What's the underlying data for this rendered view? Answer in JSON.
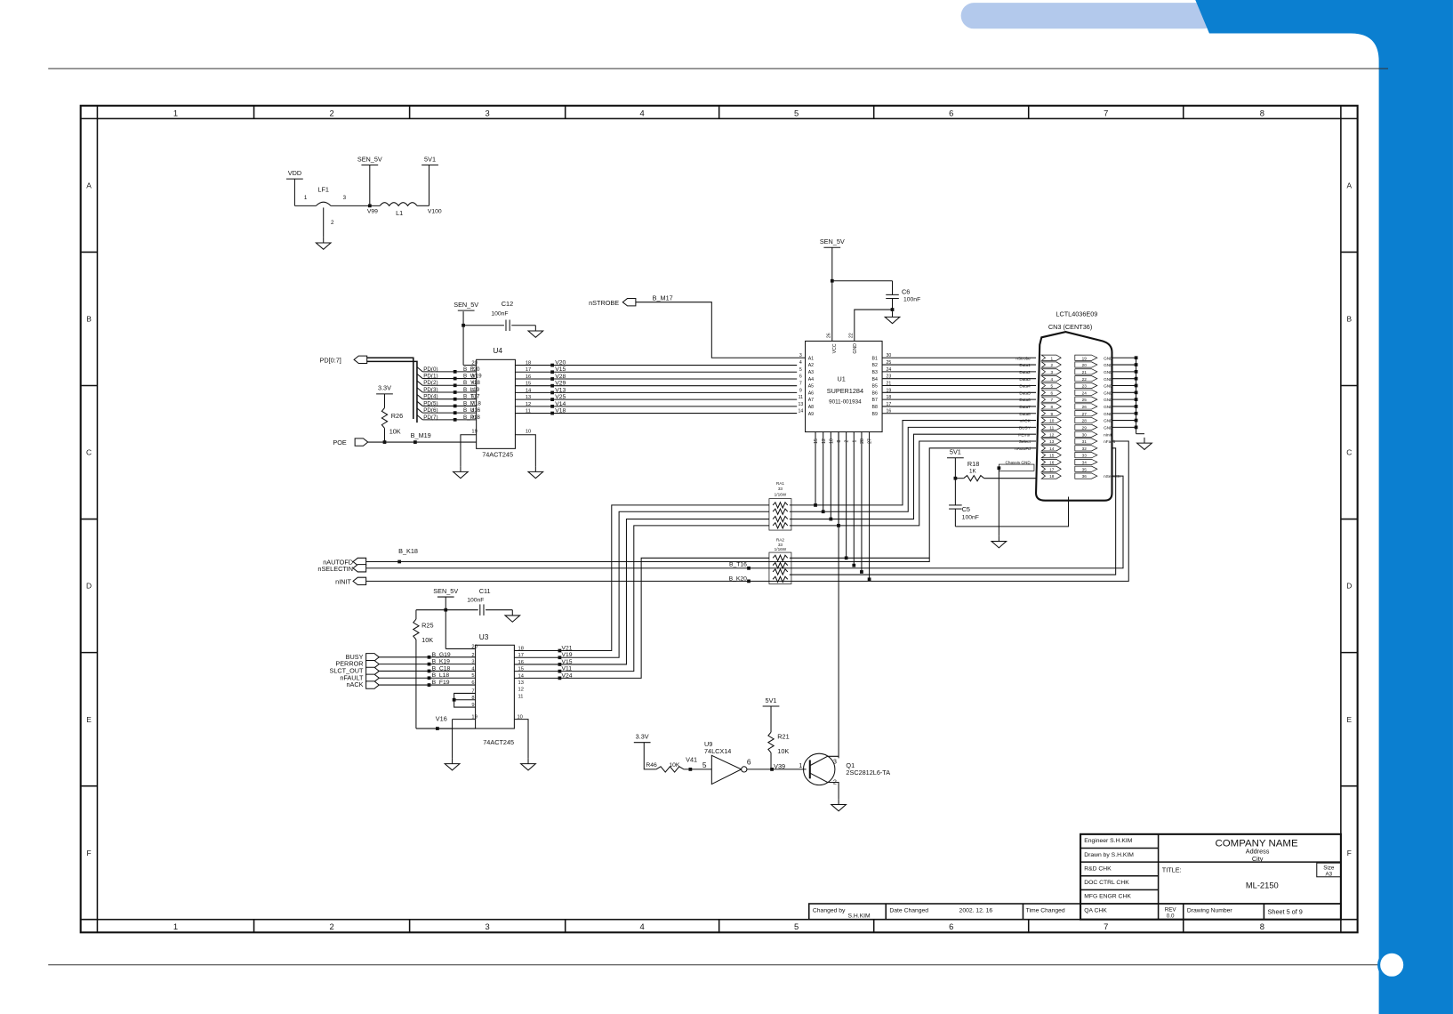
{
  "frame": {
    "columns": [
      "1",
      "2",
      "3",
      "4",
      "5",
      "6",
      "7",
      "8"
    ],
    "rows": [
      "A",
      "B",
      "C",
      "D",
      "E",
      "F"
    ]
  },
  "power": {
    "vdd": "VDD",
    "sen_5v": "SEN_5V",
    "v5v1": "5V1",
    "lf1": "LF1",
    "l1": "L1",
    "v99": "V99",
    "v100": "V100",
    "pin1": "1",
    "pin3": "3",
    "pin2": "2"
  },
  "u4": {
    "ref": "U4",
    "part": "74ACT245",
    "bus": "PD[0:7]",
    "sen_5v": "SEN_5V",
    "c12": "C12",
    "c12_val": "100nF",
    "r26": "R26",
    "r26_val": "10K",
    "v33": "3.3V",
    "poe": "POE",
    "net_g": "B_M19",
    "vcc_pin": "20",
    "g_pin": "19",
    "dir_pin": "1",
    "gnd_pin": "10",
    "pd_labels": [
      "PD(0)",
      "PD(1)",
      "PD(2)",
      "PD(3)",
      "PD(4)",
      "PD(5)",
      "PD(6)",
      "PD(7)"
    ],
    "in_nets": [
      "B_F20",
      "B_W19",
      "B_Y18",
      "B_L19",
      "B_T17",
      "B_M18",
      "B_U16",
      "B_P18"
    ],
    "in_pins": [
      "2",
      "3",
      "4",
      "5",
      "6",
      "7",
      "8",
      "9"
    ],
    "out_pins": [
      "18",
      "17",
      "16",
      "15",
      "14",
      "13",
      "12",
      "11"
    ],
    "out_nets": [
      "V20",
      "V15",
      "V28",
      "V29",
      "V13",
      "V25",
      "V14",
      "V18"
    ]
  },
  "u1": {
    "ref": "U1",
    "part": "SUPER1284",
    "code": "9011-001934",
    "sen_5v": "SEN_5V",
    "c6": "C6",
    "c6_val": "100nF",
    "vcc_pin": "26",
    "gnd_pin": "22",
    "vcc": "VCC",
    "gnd": "GND",
    "strobe": "nSTROBE",
    "strobe_net": "B_M17",
    "a_pins": [
      "A1",
      "A2",
      "A3",
      "A4",
      "A5",
      "A6",
      "A7",
      "A8",
      "A9"
    ],
    "a_nums": [
      "3",
      "4",
      "5",
      "6",
      "7",
      "9",
      "11",
      "13",
      "14"
    ],
    "b_pins": [
      "B1",
      "B2",
      "B3",
      "B4",
      "B5",
      "B6",
      "B7",
      "B8",
      "B9"
    ],
    "b_nums": [
      "30",
      "25",
      "24",
      "23",
      "21",
      "19",
      "18",
      "17",
      "16"
    ],
    "bottom_nums": [
      "15",
      "12",
      "10",
      "8",
      "2",
      "1",
      "28",
      "27"
    ]
  },
  "cn3": {
    "part": "LCTL4036E09",
    "ref": "CN3 (CENT36)",
    "left_signals": [
      "nStrobe",
      "Data1",
      "Data2",
      "Data3",
      "Data4",
      "Data5",
      "Data6",
      "Data7",
      "Data8",
      "nACK",
      "BUSY",
      "PError",
      "Select",
      "nAutoFd",
      "",
      "Chassis GND",
      "",
      ""
    ],
    "left_pins": [
      "1",
      "2",
      "3",
      "4",
      "5",
      "6",
      "7",
      "8",
      "9",
      "10",
      "11",
      "12",
      "13",
      "14",
      "15",
      "16",
      "17",
      "18"
    ],
    "right_pins": [
      "19",
      "20",
      "21",
      "22",
      "23",
      "24",
      "25",
      "26",
      "27",
      "28",
      "29",
      "30",
      "31",
      "32",
      "33",
      "34",
      "35",
      "36"
    ],
    "right_signals": [
      "GND",
      "GND",
      "GND",
      "GND",
      "GND",
      "GND",
      "GND",
      "GND",
      "GND",
      "GND",
      "GND",
      "nInit",
      "nFault",
      "",
      "",
      "",
      "",
      "nSelectIn"
    ]
  },
  "misc": {
    "r18": "R18",
    "r18_val": "1K",
    "v5v1": "5V1",
    "c5": "C5",
    "c5_val": "100nF",
    "ra1": "RA1",
    "ra2": "RA2",
    "ra_val": "33",
    "ra_watt": "1/16W",
    "nautofd": "nAUTOFD",
    "nselectin": "nSELECTIN",
    "ninit": "nINIT",
    "net_k18": "B_K18",
    "net_t16": "B_T16",
    "net_k20": "B_K20"
  },
  "u3": {
    "ref": "U3",
    "part": "74ACT245",
    "sen_5v": "SEN_5V",
    "c11": "C11",
    "c11_val": "100nF",
    "r25": "R25",
    "r25_val": "10K",
    "v16": "V16",
    "inputs": [
      "BUSY",
      "PERROR",
      "SLCT_OUT",
      "nFAULT",
      "nACK"
    ],
    "in_nets": [
      "B_G19",
      "B_K19",
      "B_C18",
      "B_L18",
      "B_F19"
    ],
    "in_pins": [
      "2",
      "3",
      "4",
      "5",
      "6"
    ],
    "tie_pins": [
      "7",
      "8",
      "9"
    ],
    "vcc_pin": "20",
    "g_pin": "19",
    "gnd_pin": "10",
    "out_pins": [
      "18",
      "17",
      "16",
      "15",
      "14",
      "13",
      "12",
      "11"
    ],
    "out_nets": [
      "V21",
      "V19",
      "V15",
      "V11",
      "V24"
    ]
  },
  "driver": {
    "v33": "3.3V",
    "r46": "R46",
    "r46_val": "10K",
    "v41": "V41",
    "u9": "U9",
    "u9_part": "74LCX14",
    "pin5": "5",
    "pin6": "6",
    "v39": "V39",
    "v5v1": "5V1",
    "r21": "R21",
    "r21_val": "10K",
    "q1": "Q1",
    "q1_part": "2SC2812L6-TA",
    "q_pin1": "1",
    "q_pin2": "2",
    "q_pin3": "3"
  },
  "title_block": {
    "engineer": "Engineer S.H.KIM",
    "drawn_by": "Drawn by S.H.KIM",
    "rd_chk": "R&D CHK",
    "doc_ctrl_chk": "DOC CTRL CHK",
    "mfg_engr_chk": "MFG ENGR CHK",
    "company": "COMPANY NAME",
    "address": "Address",
    "city": "City",
    "title_label": "TITLE:",
    "title": "ML-2150",
    "size_label": "Size",
    "size": "A3",
    "changed_by_label": "Changed by",
    "changed_by": "S.H.KIM",
    "date_changed_label": "Date Changed",
    "date_changed": "2002. 12. 16",
    "time_changed_label": "Time Changed",
    "qa_chk": "QA CHK",
    "rev_label": "REV",
    "rev": "0.0",
    "drawing_number_label": "Drawing Number",
    "sheet": "Sheet 5 of 9"
  },
  "colors": {
    "brand_blue": "#0b7fd0",
    "tab_light": "#b3c9ec",
    "ink": "#111111"
  }
}
